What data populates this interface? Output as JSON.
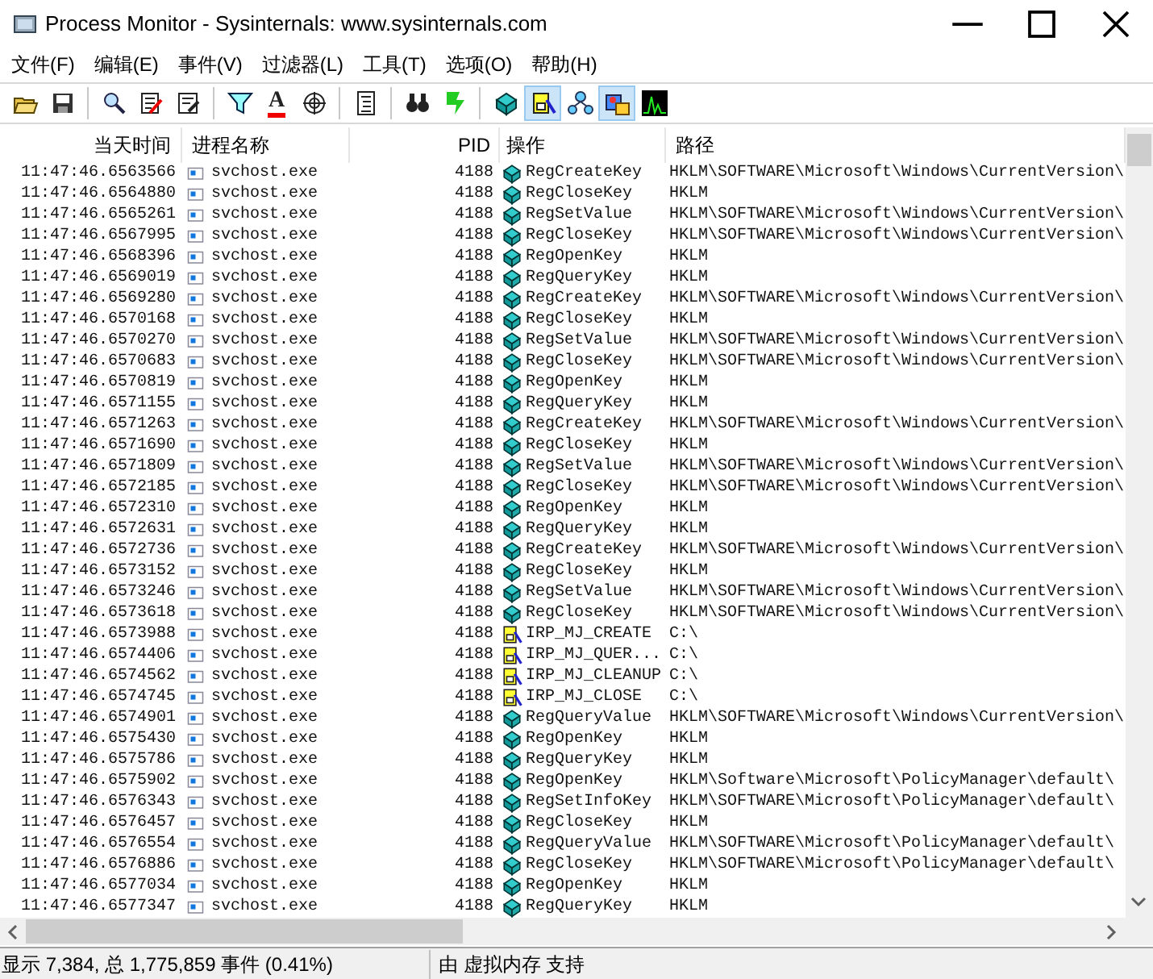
{
  "window": {
    "title": "Process Monitor - Sysinternals: www.sysinternals.com"
  },
  "menu": [
    "文件(F)",
    "编辑(E)",
    "事件(V)",
    "过滤器(L)",
    "工具(T)",
    "选项(O)",
    "帮助(H)"
  ],
  "toolbar": [
    [
      {
        "kind": "open",
        "pressed": false
      },
      {
        "kind": "save",
        "pressed": false
      }
    ],
    [
      {
        "kind": "capture",
        "pressed": false
      },
      {
        "kind": "autoscroll",
        "pressed": false
      },
      {
        "kind": "clear",
        "pressed": false
      }
    ],
    [
      {
        "kind": "filter",
        "pressed": false
      },
      {
        "kind": "highlight",
        "glyph": "A",
        "pressed": false
      },
      {
        "kind": "target",
        "pressed": false
      }
    ],
    [
      {
        "kind": "tree",
        "pressed": false
      }
    ],
    [
      {
        "kind": "find",
        "pressed": false
      },
      {
        "kind": "jump",
        "pressed": false
      }
    ],
    [
      {
        "kind": "registry",
        "pressed": false
      },
      {
        "kind": "filesystem",
        "pressed": true
      },
      {
        "kind": "network",
        "pressed": false
      },
      {
        "kind": "process",
        "pressed": true
      },
      {
        "kind": "profiling",
        "pressed": false
      }
    ]
  ],
  "table": {
    "columns": [
      "当天时间",
      "进程名称",
      "PID",
      "操作",
      "路径"
    ],
    "rows": [
      {
        "time": "11:47:46.6563566",
        "process": "svchost.exe",
        "pid": "4188",
        "kind": "registry",
        "operation": "RegCreateKey",
        "path": "HKLM\\SOFTWARE\\Microsoft\\Windows\\CurrentVersion\\"
      },
      {
        "time": "11:47:46.6564880",
        "process": "svchost.exe",
        "pid": "4188",
        "kind": "registry",
        "operation": "RegCloseKey",
        "path": "HKLM"
      },
      {
        "time": "11:47:46.6565261",
        "process": "svchost.exe",
        "pid": "4188",
        "kind": "registry",
        "operation": "RegSetValue",
        "path": "HKLM\\SOFTWARE\\Microsoft\\Windows\\CurrentVersion\\"
      },
      {
        "time": "11:47:46.6567995",
        "process": "svchost.exe",
        "pid": "4188",
        "kind": "registry",
        "operation": "RegCloseKey",
        "path": "HKLM\\SOFTWARE\\Microsoft\\Windows\\CurrentVersion\\"
      },
      {
        "time": "11:47:46.6568396",
        "process": "svchost.exe",
        "pid": "4188",
        "kind": "registry",
        "operation": "RegOpenKey",
        "path": "HKLM"
      },
      {
        "time": "11:47:46.6569019",
        "process": "svchost.exe",
        "pid": "4188",
        "kind": "registry",
        "operation": "RegQueryKey",
        "path": "HKLM"
      },
      {
        "time": "11:47:46.6569280",
        "process": "svchost.exe",
        "pid": "4188",
        "kind": "registry",
        "operation": "RegCreateKey",
        "path": "HKLM\\SOFTWARE\\Microsoft\\Windows\\CurrentVersion\\"
      },
      {
        "time": "11:47:46.6570168",
        "process": "svchost.exe",
        "pid": "4188",
        "kind": "registry",
        "operation": "RegCloseKey",
        "path": "HKLM"
      },
      {
        "time": "11:47:46.6570270",
        "process": "svchost.exe",
        "pid": "4188",
        "kind": "registry",
        "operation": "RegSetValue",
        "path": "HKLM\\SOFTWARE\\Microsoft\\Windows\\CurrentVersion\\"
      },
      {
        "time": "11:47:46.6570683",
        "process": "svchost.exe",
        "pid": "4188",
        "kind": "registry",
        "operation": "RegCloseKey",
        "path": "HKLM\\SOFTWARE\\Microsoft\\Windows\\CurrentVersion\\"
      },
      {
        "time": "11:47:46.6570819",
        "process": "svchost.exe",
        "pid": "4188",
        "kind": "registry",
        "operation": "RegOpenKey",
        "path": "HKLM"
      },
      {
        "time": "11:47:46.6571155",
        "process": "svchost.exe",
        "pid": "4188",
        "kind": "registry",
        "operation": "RegQueryKey",
        "path": "HKLM"
      },
      {
        "time": "11:47:46.6571263",
        "process": "svchost.exe",
        "pid": "4188",
        "kind": "registry",
        "operation": "RegCreateKey",
        "path": "HKLM\\SOFTWARE\\Microsoft\\Windows\\CurrentVersion\\"
      },
      {
        "time": "11:47:46.6571690",
        "process": "svchost.exe",
        "pid": "4188",
        "kind": "registry",
        "operation": "RegCloseKey",
        "path": "HKLM"
      },
      {
        "time": "11:47:46.6571809",
        "process": "svchost.exe",
        "pid": "4188",
        "kind": "registry",
        "operation": "RegSetValue",
        "path": "HKLM\\SOFTWARE\\Microsoft\\Windows\\CurrentVersion\\"
      },
      {
        "time": "11:47:46.6572185",
        "process": "svchost.exe",
        "pid": "4188",
        "kind": "registry",
        "operation": "RegCloseKey",
        "path": "HKLM\\SOFTWARE\\Microsoft\\Windows\\CurrentVersion\\"
      },
      {
        "time": "11:47:46.6572310",
        "process": "svchost.exe",
        "pid": "4188",
        "kind": "registry",
        "operation": "RegOpenKey",
        "path": "HKLM"
      },
      {
        "time": "11:47:46.6572631",
        "process": "svchost.exe",
        "pid": "4188",
        "kind": "registry",
        "operation": "RegQueryKey",
        "path": "HKLM"
      },
      {
        "time": "11:47:46.6572736",
        "process": "svchost.exe",
        "pid": "4188",
        "kind": "registry",
        "operation": "RegCreateKey",
        "path": "HKLM\\SOFTWARE\\Microsoft\\Windows\\CurrentVersion\\"
      },
      {
        "time": "11:47:46.6573152",
        "process": "svchost.exe",
        "pid": "4188",
        "kind": "registry",
        "operation": "RegCloseKey",
        "path": "HKLM"
      },
      {
        "time": "11:47:46.6573246",
        "process": "svchost.exe",
        "pid": "4188",
        "kind": "registry",
        "operation": "RegSetValue",
        "path": "HKLM\\SOFTWARE\\Microsoft\\Windows\\CurrentVersion\\"
      },
      {
        "time": "11:47:46.6573618",
        "process": "svchost.exe",
        "pid": "4188",
        "kind": "registry",
        "operation": "RegCloseKey",
        "path": "HKLM\\SOFTWARE\\Microsoft\\Windows\\CurrentVersion\\"
      },
      {
        "time": "11:47:46.6573988",
        "process": "svchost.exe",
        "pid": "4188",
        "kind": "file",
        "operation": "IRP_MJ_CREATE",
        "path": "C:\\"
      },
      {
        "time": "11:47:46.6574406",
        "process": "svchost.exe",
        "pid": "4188",
        "kind": "file",
        "operation": "IRP_MJ_QUER...",
        "path": "C:\\"
      },
      {
        "time": "11:47:46.6574562",
        "process": "svchost.exe",
        "pid": "4188",
        "kind": "file",
        "operation": "IRP_MJ_CLEANUP",
        "path": "C:\\"
      },
      {
        "time": "11:47:46.6574745",
        "process": "svchost.exe",
        "pid": "4188",
        "kind": "file",
        "operation": "IRP_MJ_CLOSE",
        "path": "C:\\"
      },
      {
        "time": "11:47:46.6574901",
        "process": "svchost.exe",
        "pid": "4188",
        "kind": "registry",
        "operation": "RegQueryValue",
        "path": "HKLM\\SOFTWARE\\Microsoft\\Windows\\CurrentVersion\\"
      },
      {
        "time": "11:47:46.6575430",
        "process": "svchost.exe",
        "pid": "4188",
        "kind": "registry",
        "operation": "RegOpenKey",
        "path": "HKLM"
      },
      {
        "time": "11:47:46.6575786",
        "process": "svchost.exe",
        "pid": "4188",
        "kind": "registry",
        "operation": "RegQueryKey",
        "path": "HKLM"
      },
      {
        "time": "11:47:46.6575902",
        "process": "svchost.exe",
        "pid": "4188",
        "kind": "registry",
        "operation": "RegOpenKey",
        "path": "HKLM\\Software\\Microsoft\\PolicyManager\\default\\"
      },
      {
        "time": "11:47:46.6576343",
        "process": "svchost.exe",
        "pid": "4188",
        "kind": "registry",
        "operation": "RegSetInfoKey",
        "path": "HKLM\\SOFTWARE\\Microsoft\\PolicyManager\\default\\"
      },
      {
        "time": "11:47:46.6576457",
        "process": "svchost.exe",
        "pid": "4188",
        "kind": "registry",
        "operation": "RegCloseKey",
        "path": "HKLM"
      },
      {
        "time": "11:47:46.6576554",
        "process": "svchost.exe",
        "pid": "4188",
        "kind": "registry",
        "operation": "RegQueryValue",
        "path": "HKLM\\SOFTWARE\\Microsoft\\PolicyManager\\default\\"
      },
      {
        "time": "11:47:46.6576886",
        "process": "svchost.exe",
        "pid": "4188",
        "kind": "registry",
        "operation": "RegCloseKey",
        "path": "HKLM\\SOFTWARE\\Microsoft\\PolicyManager\\default\\"
      },
      {
        "time": "11:47:46.6577034",
        "process": "svchost.exe",
        "pid": "4188",
        "kind": "registry",
        "operation": "RegOpenKey",
        "path": "HKLM"
      },
      {
        "time": "11:47:46.6577347",
        "process": "svchost.exe",
        "pid": "4188",
        "kind": "registry",
        "operation": "RegQueryKey",
        "path": "HKLM"
      }
    ]
  },
  "status_bar": {
    "events": "显示 7,384, 总 1,775,859 事件 (0.41%)",
    "backing": "由 虚拟内存 支持"
  }
}
